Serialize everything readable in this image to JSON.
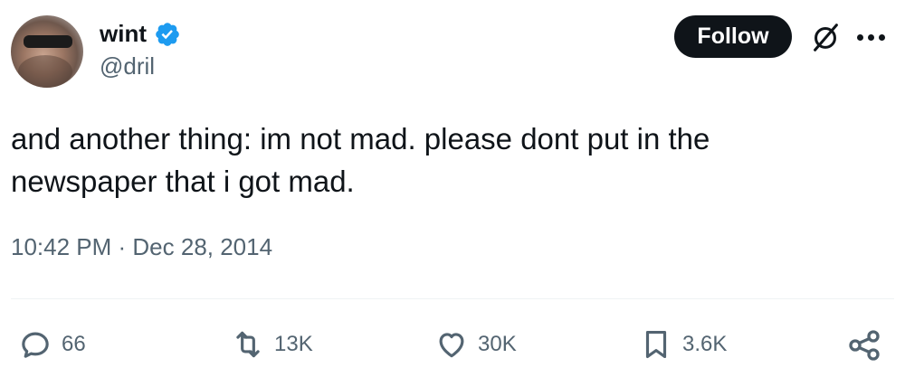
{
  "tweet": {
    "display_name": "wint",
    "handle": "@dril",
    "text": "and another thing: im not mad. please dont put in the newspaper that i got mad.",
    "timestamp": "10:42 PM · Dec 28, 2014"
  },
  "header": {
    "follow_label": "Follow",
    "icons": [
      "verified-badge-icon",
      "grok-icon",
      "more-icon"
    ]
  },
  "actions": {
    "replies": "66",
    "reposts": "13K",
    "likes": "30K",
    "bookmarks": "3.6K",
    "icons": [
      "reply-icon",
      "repost-icon",
      "like-icon",
      "bookmark-icon",
      "share-icon"
    ]
  },
  "colors": {
    "text": "#0f1419",
    "secondary": "#536471",
    "verified": "#1d9bf0",
    "follow_bg": "#0f1419"
  }
}
